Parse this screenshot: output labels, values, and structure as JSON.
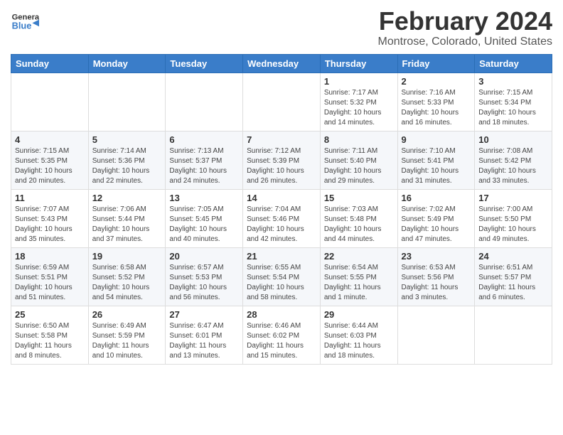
{
  "header": {
    "logo_line1": "General",
    "logo_line2": "Blue",
    "title": "February 2024",
    "subtitle": "Montrose, Colorado, United States"
  },
  "calendar": {
    "days_of_week": [
      "Sunday",
      "Monday",
      "Tuesday",
      "Wednesday",
      "Thursday",
      "Friday",
      "Saturday"
    ],
    "weeks": [
      [
        {
          "day": "",
          "info": ""
        },
        {
          "day": "",
          "info": ""
        },
        {
          "day": "",
          "info": ""
        },
        {
          "day": "",
          "info": ""
        },
        {
          "day": "1",
          "info": "Sunrise: 7:17 AM\nSunset: 5:32 PM\nDaylight: 10 hours\nand 14 minutes."
        },
        {
          "day": "2",
          "info": "Sunrise: 7:16 AM\nSunset: 5:33 PM\nDaylight: 10 hours\nand 16 minutes."
        },
        {
          "day": "3",
          "info": "Sunrise: 7:15 AM\nSunset: 5:34 PM\nDaylight: 10 hours\nand 18 minutes."
        }
      ],
      [
        {
          "day": "4",
          "info": "Sunrise: 7:15 AM\nSunset: 5:35 PM\nDaylight: 10 hours\nand 20 minutes."
        },
        {
          "day": "5",
          "info": "Sunrise: 7:14 AM\nSunset: 5:36 PM\nDaylight: 10 hours\nand 22 minutes."
        },
        {
          "day": "6",
          "info": "Sunrise: 7:13 AM\nSunset: 5:37 PM\nDaylight: 10 hours\nand 24 minutes."
        },
        {
          "day": "7",
          "info": "Sunrise: 7:12 AM\nSunset: 5:39 PM\nDaylight: 10 hours\nand 26 minutes."
        },
        {
          "day": "8",
          "info": "Sunrise: 7:11 AM\nSunset: 5:40 PM\nDaylight: 10 hours\nand 29 minutes."
        },
        {
          "day": "9",
          "info": "Sunrise: 7:10 AM\nSunset: 5:41 PM\nDaylight: 10 hours\nand 31 minutes."
        },
        {
          "day": "10",
          "info": "Sunrise: 7:08 AM\nSunset: 5:42 PM\nDaylight: 10 hours\nand 33 minutes."
        }
      ],
      [
        {
          "day": "11",
          "info": "Sunrise: 7:07 AM\nSunset: 5:43 PM\nDaylight: 10 hours\nand 35 minutes."
        },
        {
          "day": "12",
          "info": "Sunrise: 7:06 AM\nSunset: 5:44 PM\nDaylight: 10 hours\nand 37 minutes."
        },
        {
          "day": "13",
          "info": "Sunrise: 7:05 AM\nSunset: 5:45 PM\nDaylight: 10 hours\nand 40 minutes."
        },
        {
          "day": "14",
          "info": "Sunrise: 7:04 AM\nSunset: 5:46 PM\nDaylight: 10 hours\nand 42 minutes."
        },
        {
          "day": "15",
          "info": "Sunrise: 7:03 AM\nSunset: 5:48 PM\nDaylight: 10 hours\nand 44 minutes."
        },
        {
          "day": "16",
          "info": "Sunrise: 7:02 AM\nSunset: 5:49 PM\nDaylight: 10 hours\nand 47 minutes."
        },
        {
          "day": "17",
          "info": "Sunrise: 7:00 AM\nSunset: 5:50 PM\nDaylight: 10 hours\nand 49 minutes."
        }
      ],
      [
        {
          "day": "18",
          "info": "Sunrise: 6:59 AM\nSunset: 5:51 PM\nDaylight: 10 hours\nand 51 minutes."
        },
        {
          "day": "19",
          "info": "Sunrise: 6:58 AM\nSunset: 5:52 PM\nDaylight: 10 hours\nand 54 minutes."
        },
        {
          "day": "20",
          "info": "Sunrise: 6:57 AM\nSunset: 5:53 PM\nDaylight: 10 hours\nand 56 minutes."
        },
        {
          "day": "21",
          "info": "Sunrise: 6:55 AM\nSunset: 5:54 PM\nDaylight: 10 hours\nand 58 minutes."
        },
        {
          "day": "22",
          "info": "Sunrise: 6:54 AM\nSunset: 5:55 PM\nDaylight: 11 hours\nand 1 minute."
        },
        {
          "day": "23",
          "info": "Sunrise: 6:53 AM\nSunset: 5:56 PM\nDaylight: 11 hours\nand 3 minutes."
        },
        {
          "day": "24",
          "info": "Sunrise: 6:51 AM\nSunset: 5:57 PM\nDaylight: 11 hours\nand 6 minutes."
        }
      ],
      [
        {
          "day": "25",
          "info": "Sunrise: 6:50 AM\nSunset: 5:58 PM\nDaylight: 11 hours\nand 8 minutes."
        },
        {
          "day": "26",
          "info": "Sunrise: 6:49 AM\nSunset: 5:59 PM\nDaylight: 11 hours\nand 10 minutes."
        },
        {
          "day": "27",
          "info": "Sunrise: 6:47 AM\nSunset: 6:01 PM\nDaylight: 11 hours\nand 13 minutes."
        },
        {
          "day": "28",
          "info": "Sunrise: 6:46 AM\nSunset: 6:02 PM\nDaylight: 11 hours\nand 15 minutes."
        },
        {
          "day": "29",
          "info": "Sunrise: 6:44 AM\nSunset: 6:03 PM\nDaylight: 11 hours\nand 18 minutes."
        },
        {
          "day": "",
          "info": ""
        },
        {
          "day": "",
          "info": ""
        }
      ]
    ]
  }
}
